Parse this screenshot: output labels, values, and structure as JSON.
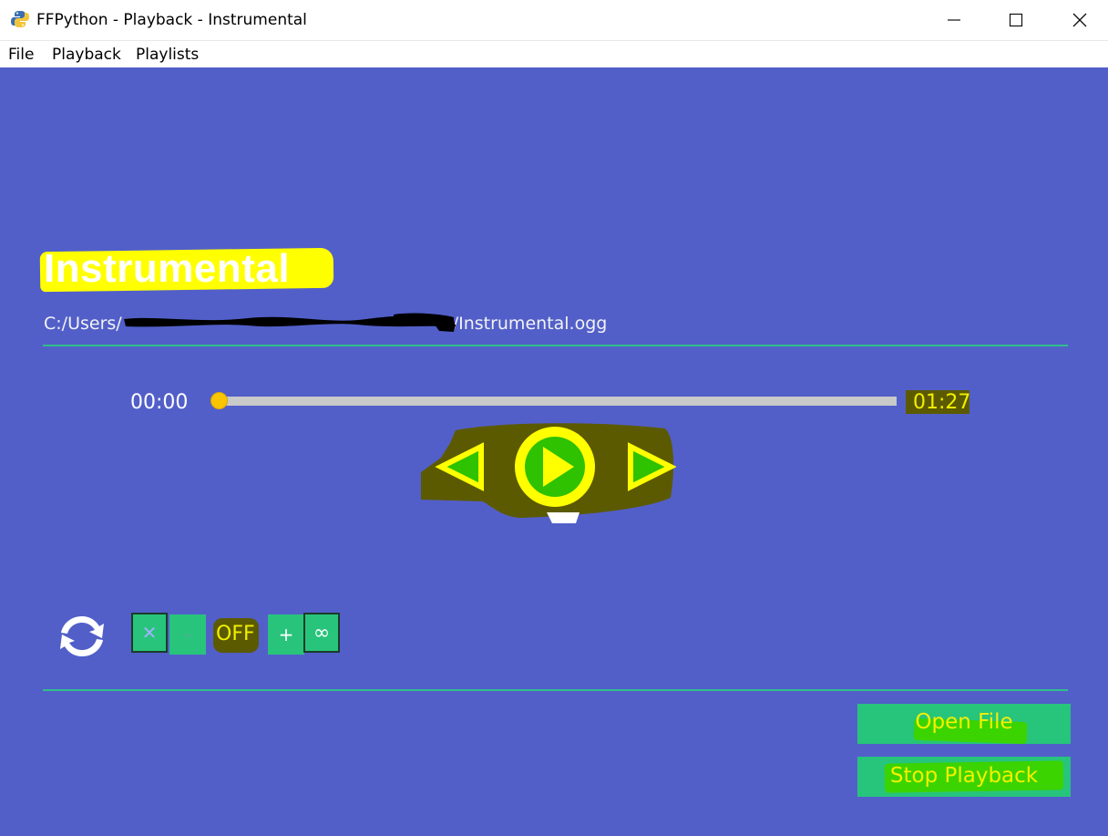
{
  "window": {
    "title": "FFPython - Playback - Instrumental",
    "icon": "python-icon",
    "controls": [
      "minimize-icon",
      "maximize-icon",
      "close-icon"
    ]
  },
  "menu": {
    "items": [
      {
        "label": "File"
      },
      {
        "label": "Playback"
      },
      {
        "label": "Playlists"
      }
    ]
  },
  "track": {
    "title": "Instrumental",
    "path": "C:/Users/",
    "path_suffix": "/Instrumental.ogg"
  },
  "seek": {
    "current_time": "00:00",
    "total_time": "01:27",
    "progress": 0
  },
  "transport": {
    "icons": [
      "previous-icon",
      "play-icon",
      "next-icon"
    ]
  },
  "loop": {
    "icon": "repeat-icon",
    "clear_label": "✕",
    "decrement_label": "-",
    "status": "OFF",
    "increment_label": "+",
    "infinite_label": "∞"
  },
  "actions": {
    "open_file": "Open File",
    "stop_playback": "Stop Playback"
  },
  "colors": {
    "background": "#525fc9",
    "accent_green": "#27c47c",
    "knob": "#f9c400",
    "highlight_yellow": "#ffff00",
    "highlight_olive": "#5c5a00"
  }
}
